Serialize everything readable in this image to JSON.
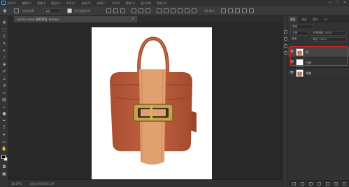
{
  "menubar": {
    "items": [
      "文件(F)",
      "编辑(E)",
      "图像(I)",
      "图层(L)",
      "文字(Y)",
      "选择(S)",
      "滤镜(T)",
      "3D(D)",
      "视图(V)",
      "窗口(W)",
      "帮助(H)"
    ],
    "window_buttons": [
      "—",
      "▢",
      "✕"
    ]
  },
  "optionsbar": {
    "tool_icon": "move-tool-icon",
    "labels": [
      "自动选择:",
      "图层",
      "显示变换控件",
      "3D 模式:"
    ]
  },
  "document": {
    "tab_title": "U4250×4250 (橙色背包, RGB/8) *",
    "tab_close": "×",
    "zoom": "16.67%",
    "info": "文档:8.78M/26.3M"
  },
  "panel": {
    "tabs": [
      "图层",
      "通道",
      "路径",
      "3D"
    ],
    "filter_label": "类型",
    "blend_mode": "正常",
    "opacity_label": "不透明度: 100%",
    "lock_label": "锁定:",
    "fill_label": "填充: 100%",
    "layers": [
      {
        "name": "包",
        "visible": true,
        "selected": true,
        "thumb": "bag"
      },
      {
        "name": "白底",
        "visible": true,
        "selected": false,
        "thumb": "white"
      },
      {
        "name": "背景",
        "visible": true,
        "selected": false,
        "thumb": "bag-small"
      }
    ]
  },
  "colors": {
    "accent_highlight": "#d62828",
    "bag_main": "#b85a3a",
    "bag_strap": "#e3a070",
    "buckle": "#c8a24a",
    "foreground": "#000000",
    "background": "#ffffff"
  }
}
